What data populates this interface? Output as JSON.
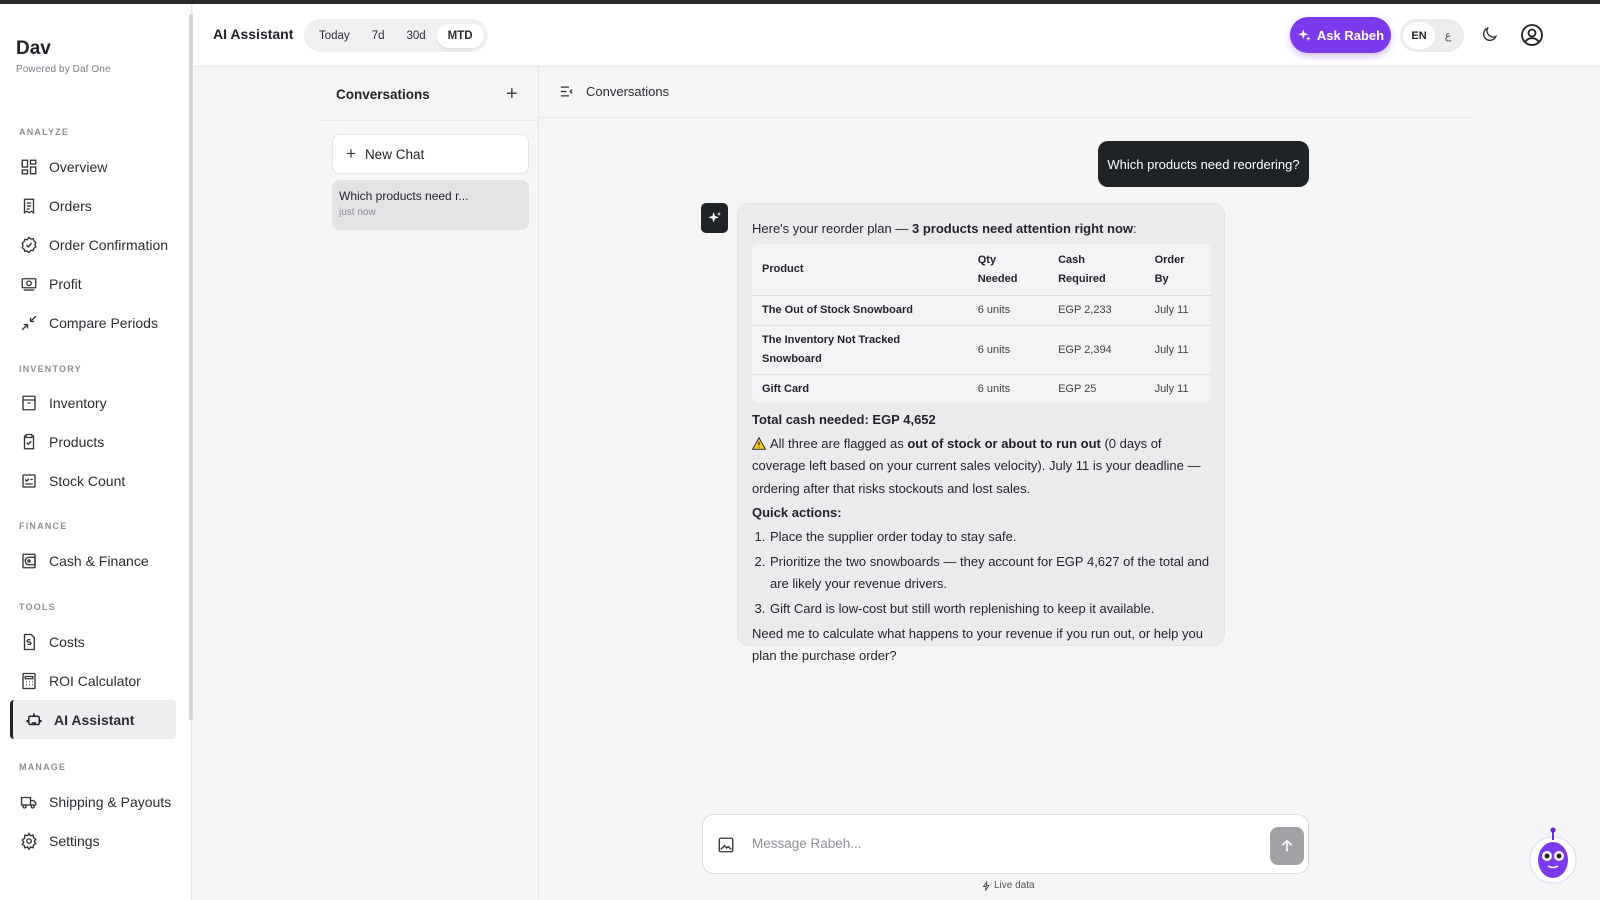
{
  "brand": {
    "name": "Dav",
    "subtitle": "Powered by Daf One"
  },
  "sidebar": {
    "sections": [
      {
        "label": "ANALYZE",
        "items": [
          {
            "label": "Overview",
            "icon": "grid-icon"
          },
          {
            "label": "Orders",
            "icon": "receipt-icon"
          },
          {
            "label": "Order Confirmation",
            "icon": "badge-check-icon"
          },
          {
            "label": "Profit",
            "icon": "cash-icon"
          },
          {
            "label": "Compare Periods",
            "icon": "compare-arrows-icon"
          }
        ]
      },
      {
        "label": "INVENTORY",
        "items": [
          {
            "label": "Inventory",
            "icon": "archive-icon"
          },
          {
            "label": "Products",
            "icon": "clipboard-icon"
          },
          {
            "label": "Stock Count",
            "icon": "checklist-icon"
          }
        ]
      },
      {
        "label": "FINANCE",
        "items": [
          {
            "label": "Cash & Finance",
            "icon": "wallet-icon"
          }
        ]
      },
      {
        "label": "TOOLS",
        "items": [
          {
            "label": "Costs",
            "icon": "dollar-file-icon"
          },
          {
            "label": "ROI Calculator",
            "icon": "calculator-icon"
          },
          {
            "label": "AI Assistant",
            "icon": "bot-icon",
            "active": true
          }
        ]
      },
      {
        "label": "MANAGE",
        "items": [
          {
            "label": "Shipping & Payouts",
            "icon": "truck-icon"
          },
          {
            "label": "Settings",
            "icon": "gear-icon"
          }
        ]
      }
    ]
  },
  "header": {
    "title": "AI Assistant",
    "ranges": [
      "Today",
      "7d",
      "30d",
      "MTD"
    ],
    "selected_range": "MTD",
    "ask_button": "Ask Rabeh",
    "lang_primary": "EN",
    "lang_secondary": "ع"
  },
  "conversations": {
    "title": "Conversations",
    "new_chat": "New Chat",
    "items": [
      {
        "title": "Which products need r...",
        "time": "just now"
      }
    ]
  },
  "chat": {
    "header_label": "Conversations",
    "user_message": "Which products need reordering?",
    "intro_prefix": "Here's your reorder plan — ",
    "intro_bold": "3 products need attention right now",
    "intro_suffix": ":",
    "table": {
      "headers": [
        "Product",
        "Qty Needed",
        "Cash Required",
        "Order By"
      ],
      "rows": [
        [
          "The Out of Stock Snowboard",
          "6 units",
          "EGP 2,233",
          "July 11"
        ],
        [
          "The Inventory Not Tracked Snowboard",
          "6 units",
          "EGP 2,394",
          "July 11"
        ],
        [
          "Gift Card",
          "6 units",
          "EGP 25",
          "July 11"
        ]
      ]
    },
    "total": "Total cash needed: EGP 4,652",
    "warning_prefix": "All three are flagged as ",
    "warning_bold": "out of stock or about to run out",
    "warning_suffix": " (0 days of coverage left based on your current sales velocity). July 11 is your deadline — ordering after that risks stockouts and lost sales.",
    "quick_actions_title": "Quick actions:",
    "quick_actions": [
      "Place the supplier order today to stay safe.",
      "Prioritize the two snowboards — they account for EGP 4,627 of the total and are likely your revenue drivers.",
      "Gift Card is low-cost but still worth replenishing to keep it available."
    ],
    "closing": "Need me to calculate what happens to your revenue if you run out, or help you plan the purchase order?"
  },
  "composer": {
    "placeholder": "Message Rabeh...",
    "live_label": "Live data"
  },
  "colors": {
    "accent": "#7c3aed",
    "dark": "#1f2328",
    "bubble": "#ebebed"
  }
}
